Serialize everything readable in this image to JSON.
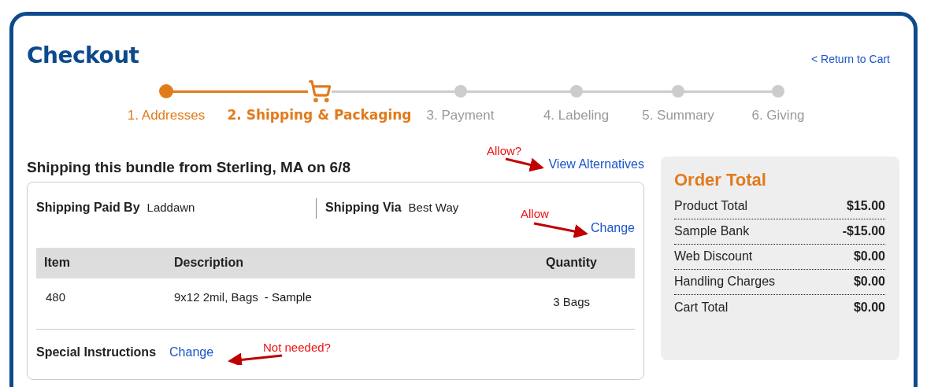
{
  "title": "Checkout",
  "return_link": "< Return to Cart",
  "steps": [
    {
      "label": "1. Addresses",
      "selected": false
    },
    {
      "label": "2. Shipping & Packaging",
      "selected": true
    },
    {
      "label": "3. Payment",
      "selected": false
    },
    {
      "label": "4. Labeling",
      "selected": false
    },
    {
      "label": "5. Summary",
      "selected": false
    },
    {
      "label": "6. Giving",
      "selected": false
    }
  ],
  "bundle": {
    "heading": "Shipping this bundle from Sterling, MA on 6/8",
    "alternatives_link": "View Alternatives",
    "paid_by": {
      "label": "Shipping Paid By",
      "value": "Laddawn"
    },
    "via": {
      "label": "Shipping Via",
      "value": "Best Way"
    },
    "change_link": "Change",
    "table": {
      "columns": [
        "Item",
        "Description",
        "Quantity"
      ],
      "rows": [
        {
          "item": "480",
          "description": "9x12 2mil, Bags",
          "tag": "- Sample",
          "quantity": "3 Bags"
        }
      ]
    },
    "special_instructions": {
      "label": "Special Instructions",
      "link": "Change"
    }
  },
  "order_total": {
    "title": "Order Total",
    "rows": [
      {
        "label": "Product Total",
        "value": "$15.00"
      },
      {
        "label": "Sample Bank",
        "value": "-$15.00"
      },
      {
        "label": "Web Discount",
        "value": "$0.00"
      },
      {
        "label": "Handling Charges",
        "value": "$0.00"
      },
      {
        "label": "Cart Total",
        "value": "$0.00"
      }
    ]
  },
  "annotations": [
    {
      "text": "Allow?"
    },
    {
      "text": "Allow"
    },
    {
      "text": "Not needed?"
    }
  ]
}
